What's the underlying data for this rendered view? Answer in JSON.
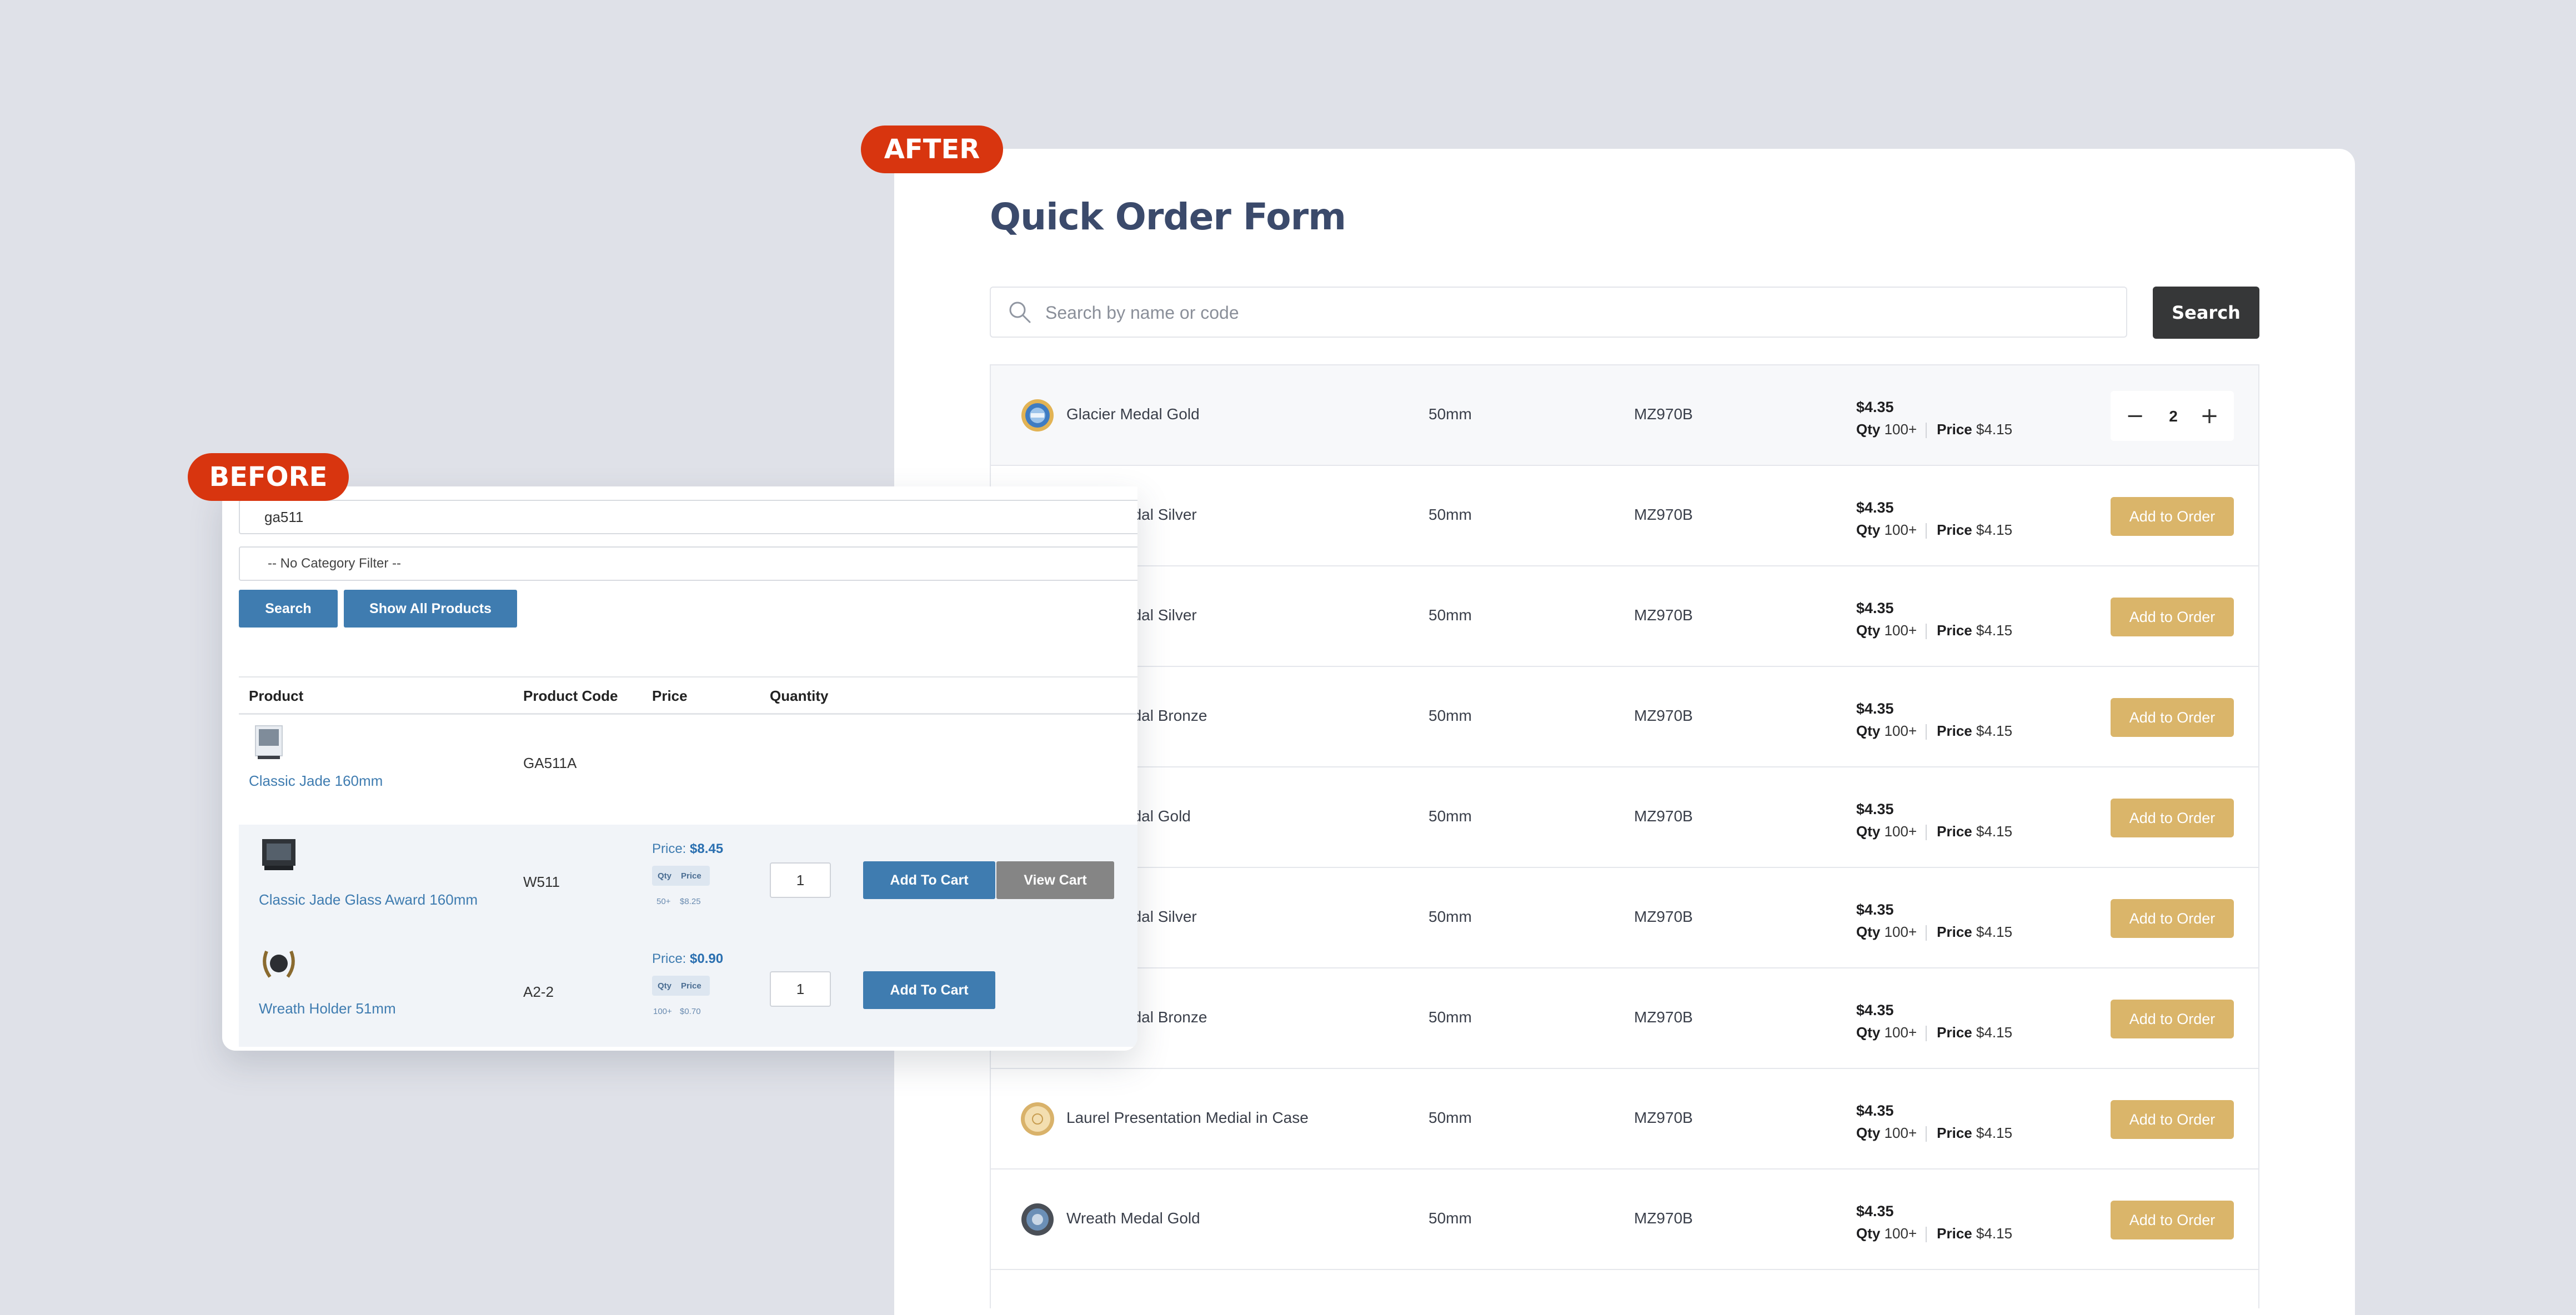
{
  "labels": {
    "after": "AFTER",
    "before": "BEFORE"
  },
  "after": {
    "title": "Quick Order Form",
    "search": {
      "placeholder": "Search by name or code",
      "button": "Search"
    },
    "add_label": "Add to Order",
    "qty_label": "Qty",
    "price_label": "Price",
    "stepper": {
      "minus": "−",
      "plus": "+",
      "value": "2"
    },
    "rows": [
      {
        "name": "Glacier Medal Gold",
        "size": "50mm",
        "code": "MZ970B",
        "price": "$4.35",
        "tier_qty": "100+",
        "tier_price": "$4.15",
        "medal": "blue-ring"
      },
      {
        "name": "Glacier Medal Silver",
        "visible_name": "edal Silver",
        "size": "50mm",
        "code": "MZ970B",
        "price": "$4.35",
        "tier_qty": "100+",
        "tier_price": "$4.15"
      },
      {
        "name": "Glacier Medal Silver",
        "visible_name": "edal Silver",
        "size": "50mm",
        "code": "MZ970B",
        "price": "$4.35",
        "tier_qty": "100+",
        "tier_price": "$4.15"
      },
      {
        "name": "Glacier Medal Bronze",
        "visible_name": "edal Bronze",
        "size": "50mm",
        "code": "MZ970B",
        "price": "$4.35",
        "tier_qty": "100+",
        "tier_price": "$4.15"
      },
      {
        "name": "Glacier Medal Gold",
        "visible_name": "edal Gold",
        "size": "50mm",
        "code": "MZ970B",
        "price": "$4.35",
        "tier_qty": "100+",
        "tier_price": "$4.15"
      },
      {
        "name": "Glacier Medal Silver",
        "visible_name": "edal Silver",
        "size": "50mm",
        "code": "MZ970B",
        "price": "$4.35",
        "tier_qty": "100+",
        "tier_price": "$4.15"
      },
      {
        "name": "Glacier Medal Bronze",
        "visible_name": "edal Bronze",
        "size": "50mm",
        "code": "MZ970B",
        "price": "$4.35",
        "tier_qty": "100+",
        "tier_price": "$4.15"
      },
      {
        "name": "Laurel Presentation Medial in Case",
        "size": "50mm",
        "code": "MZ970B",
        "price": "$4.35",
        "tier_qty": "100+",
        "tier_price": "$4.15",
        "medal": "gold"
      },
      {
        "name": "Wreath Medal Gold",
        "size": "50mm",
        "code": "MZ970B",
        "price": "$4.35",
        "tier_qty": "100+",
        "tier_price": "$4.15",
        "medal": "dark"
      }
    ]
  },
  "before": {
    "query": "ga511",
    "category": "-- No Category Filter --",
    "search_button": "Search",
    "show_all_button": "Show All Products",
    "headers": {
      "product": "Product",
      "code": "Product Code",
      "price": "Price",
      "quantity": "Quantity"
    },
    "rows": [
      {
        "name": "Classic Jade 160mm",
        "code": "GA511A"
      },
      {
        "name": "Classic Jade Glass Award 160mm",
        "code": "W511",
        "price_prefix": "Price:",
        "price": "$8.45",
        "pill_qty": "Qty",
        "pill_price": "Price",
        "tier_qty": "50+",
        "tier_price": "$8.25",
        "qty": "1",
        "cart_button": "Add To Cart",
        "view_button": "View Cart"
      },
      {
        "name": "Wreath Holder 51mm",
        "code": "A2-2",
        "price_prefix": "Price:",
        "price": "$0.90",
        "pill_qty": "Qty",
        "pill_price": "Price",
        "tier_qty": "100+",
        "tier_price": "$0.70",
        "qty": "1",
        "cart_button": "Add To Cart"
      }
    ]
  },
  "colors": {
    "tag": "#d8350f",
    "gold_button": "#dab56a",
    "dark_button": "#363738",
    "before_blue": "#3f7cb0"
  }
}
